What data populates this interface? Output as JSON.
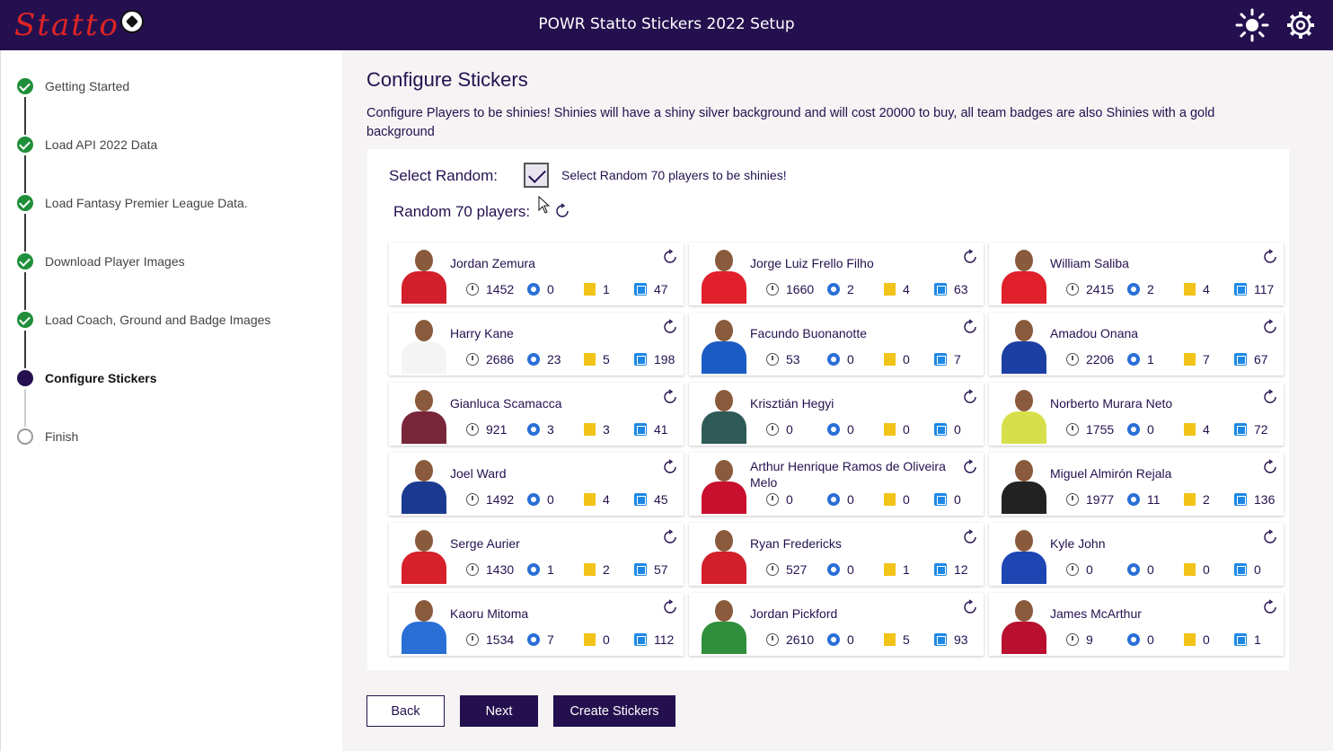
{
  "titlebar": {
    "logo": "Statto",
    "title": "POWR Statto Stickers 2022 Setup",
    "icons": [
      "sun-icon",
      "gear-icon"
    ]
  },
  "sidebar": {
    "steps": [
      {
        "label": "Getting Started",
        "state": "done"
      },
      {
        "label": "Load API 2022 Data",
        "state": "done"
      },
      {
        "label": "Load Fantasy Premier League Data.",
        "state": "done"
      },
      {
        "label": "Download Player Images",
        "state": "done"
      },
      {
        "label": "Load Coach, Ground and Badge Images",
        "state": "done"
      },
      {
        "label": "Configure Stickers",
        "state": "active"
      },
      {
        "label": "Finish",
        "state": "todo"
      }
    ]
  },
  "main": {
    "title": "Configure Stickers",
    "description": "Configure Players to be shinies! Shinies will have a shiny silver background and will cost 20000 to buy, all team badges are also Shinies with a gold background",
    "select_random_label": "Select Random:",
    "select_random_checked": true,
    "select_random_text": "Select Random 70 players to be shinies!",
    "random_players_label": "Random 70 players:"
  },
  "players": [
    {
      "name": "Jordan Zemura",
      "minutes": "1452",
      "goals": "0",
      "yellow": "1",
      "points": "47",
      "shirt": "#d21f2b"
    },
    {
      "name": "Jorge Luiz Frello Filho",
      "minutes": "1660",
      "goals": "2",
      "yellow": "4",
      "points": "63",
      "shirt": "#e0202a"
    },
    {
      "name": "William Saliba",
      "minutes": "2415",
      "goals": "2",
      "yellow": "4",
      "points": "117",
      "shirt": "#e0202a"
    },
    {
      "name": "Harry Kane",
      "minutes": "2686",
      "goals": "23",
      "yellow": "5",
      "points": "198",
      "shirt": "#f4f4f4"
    },
    {
      "name": "Facundo Buonanotte",
      "minutes": "53",
      "goals": "0",
      "yellow": "0",
      "points": "7",
      "shirt": "#1b5cc4"
    },
    {
      "name": "Amadou Onana",
      "minutes": "2206",
      "goals": "1",
      "yellow": "7",
      "points": "67",
      "shirt": "#1c3fa3"
    },
    {
      "name": "Gianluca Scamacca",
      "minutes": "921",
      "goals": "3",
      "yellow": "3",
      "points": "41",
      "shirt": "#7a263a"
    },
    {
      "name": "Krisztián Hegyi",
      "minutes": "0",
      "goals": "0",
      "yellow": "0",
      "points": "0",
      "shirt": "#2f5a57"
    },
    {
      "name": "Norberto Murara Neto",
      "minutes": "1755",
      "goals": "0",
      "yellow": "4",
      "points": "72",
      "shirt": "#d7e04a"
    },
    {
      "name": "Joel Ward",
      "minutes": "1492",
      "goals": "0",
      "yellow": "4",
      "points": "45",
      "shirt": "#1b3a8f"
    },
    {
      "name": "Arthur Henrique Ramos de Oliveira Melo",
      "minutes": "0",
      "goals": "0",
      "yellow": "0",
      "points": "0",
      "shirt": "#c8102e"
    },
    {
      "name": "Miguel Almirón Rejala",
      "minutes": "1977",
      "goals": "11",
      "yellow": "2",
      "points": "136",
      "shirt": "#222222"
    },
    {
      "name": "Serge Aurier",
      "minutes": "1430",
      "goals": "1",
      "yellow": "2",
      "points": "57",
      "shirt": "#d6202a"
    },
    {
      "name": "Ryan Fredericks",
      "minutes": "527",
      "goals": "0",
      "yellow": "1",
      "points": "12",
      "shirt": "#d21f2b"
    },
    {
      "name": "Kyle John",
      "minutes": "0",
      "goals": "0",
      "yellow": "0",
      "points": "0",
      "shirt": "#1d46b3"
    },
    {
      "name": "Kaoru Mitoma",
      "minutes": "1534",
      "goals": "7",
      "yellow": "0",
      "points": "112",
      "shirt": "#2a6fd6"
    },
    {
      "name": "Jordan Pickford",
      "minutes": "2610",
      "goals": "0",
      "yellow": "5",
      "points": "93",
      "shirt": "#2f8f3a"
    },
    {
      "name": "James McArthur",
      "minutes": "9",
      "goals": "0",
      "yellow": "0",
      "points": "1",
      "shirt": "#b8102e"
    }
  ],
  "buttons": {
    "back": "Back",
    "next": "Next",
    "create": "Create Stickers"
  }
}
